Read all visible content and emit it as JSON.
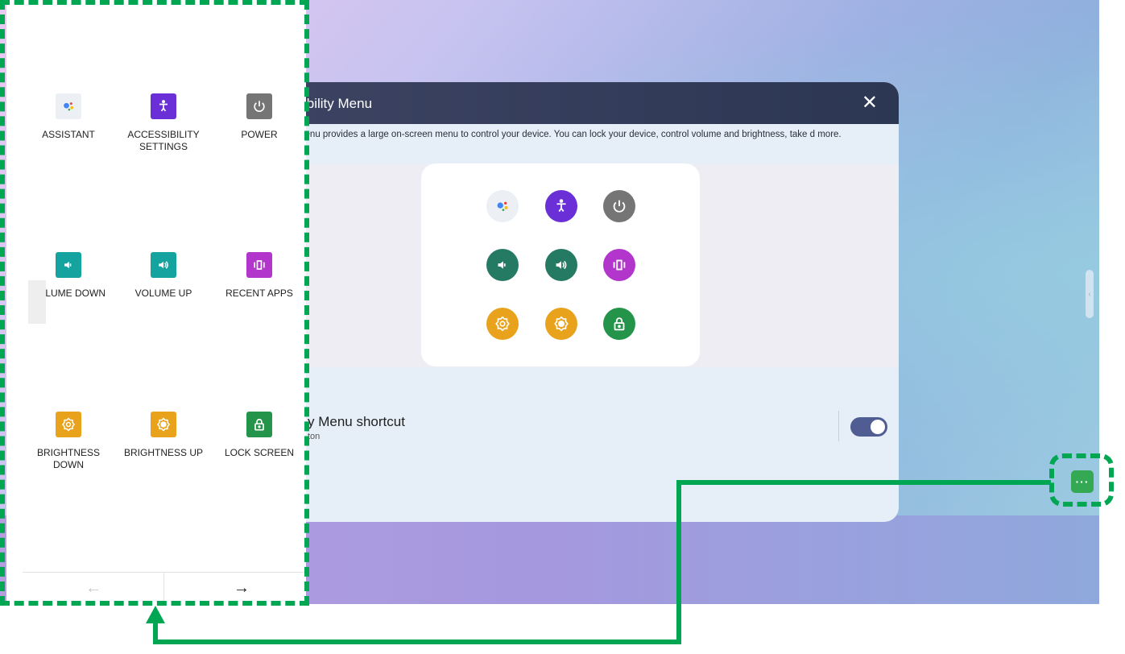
{
  "colors": {
    "highlight": "#00a651",
    "header": "#2f3957",
    "toggle": "#4f5d93",
    "float_button": "#34a853",
    "teal": "#15a3a0",
    "purple": "#6a2fd6",
    "magenta": "#b336cc",
    "orange": "#e8a21b",
    "green": "#23944a",
    "gray": "#757575"
  },
  "dialog": {
    "title": "ssibility Menu",
    "close_icon": "close-icon",
    "description": "y Menu provides a large on-screen menu to control your device. You can lock your device, control volume and brightness, take d more.",
    "shortcut_title": "y Menu shortcut",
    "shortcut_subtitle": "ton",
    "shortcut_enabled": true
  },
  "menu_panel": {
    "tiles": [
      {
        "label": "ASSISTANT",
        "icon": "assistant-icon"
      },
      {
        "label": "ACCESSIBILITY SETTINGS",
        "icon": "accessibility-icon"
      },
      {
        "label": "POWER",
        "icon": "power-icon"
      },
      {
        "label": "VOLUME DOWN",
        "icon": "volume-down-icon"
      },
      {
        "label": "VOLUME UP",
        "icon": "volume-up-icon"
      },
      {
        "label": "RECENT APPS",
        "icon": "recent-apps-icon"
      },
      {
        "label": "BRIGHTNESS DOWN",
        "icon": "brightness-down-icon"
      },
      {
        "label": "BRIGHTNESS UP",
        "icon": "brightness-up-icon"
      },
      {
        "label": "LOCK SCREEN",
        "icon": "lock-icon"
      }
    ],
    "nav": {
      "prev": "←",
      "next": "→"
    }
  },
  "floating_button": {
    "label": "···"
  }
}
